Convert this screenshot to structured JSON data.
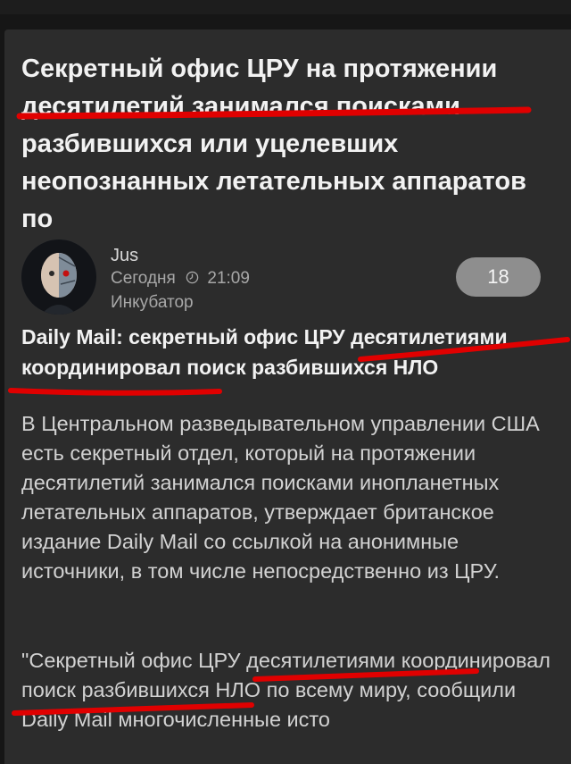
{
  "article": {
    "title": "Секретный офис ЦРУ на протяжении десятилетий занимался поисками разбившихся или уцелевших неопознанных летательных аппаратов по",
    "author": {
      "name": "Jus",
      "avatar_icon": "cyborg-avatar-icon"
    },
    "meta": {
      "date": "Сегодня",
      "time": "21:09",
      "community": "Инкубатор"
    },
    "rating": "18",
    "subtitle": "Daily Mail: секретный офис ЦРУ десятилетиями координировал поиск разбившихся НЛО",
    "paragraphs": [
      "В Центральном разведывательном управлении США есть секретный отдел, который на протяжении десятилетий занимался поисками инопланетных летательных аппаратов, утверждает британское издание Daily Mail со ссылкой на анонимные источники, в том числе непосредственно из ЦРУ.",
      "\"Секретный офис ЦРУ десятилетиями координировал поиск разбившихся НЛО по всему миру, сообщили Daily Mail многочисленные исто"
    ]
  },
  "colors": {
    "background": "#161616",
    "card": "#2c2c2c",
    "title_text": "#f2f2f2",
    "body_text": "#d2d2d2",
    "meta_text": "#a8a8a8",
    "rating_pill": "#8e8e8e",
    "annotation": "#e00000"
  },
  "icons": {
    "time": "clock-icon"
  }
}
